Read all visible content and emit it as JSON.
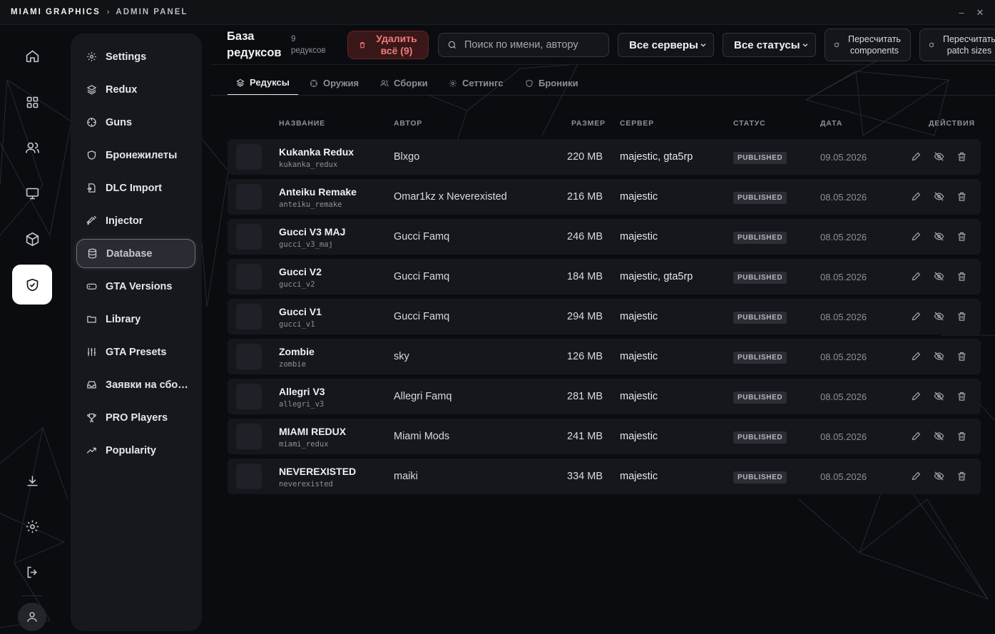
{
  "titlebar": {
    "app": "MIAMI GRAPHICS",
    "separator": "›",
    "section": "ADMIN PANEL",
    "minimize": "–",
    "close": "✕"
  },
  "rail": {
    "items": [
      "home-icon",
      "grid-icon",
      "users-icon",
      "monitor-icon",
      "cube-icon",
      "shield-check-icon",
      "download-icon",
      "gear-icon",
      "logout-icon"
    ],
    "active": "shield-check-icon",
    "avatar": "user-icon"
  },
  "sidebar": {
    "items": [
      {
        "label": "Settings",
        "icon": "gear-icon"
      },
      {
        "label": "Redux",
        "icon": "layers-icon"
      },
      {
        "label": "Guns",
        "icon": "crosshair-icon"
      },
      {
        "label": "Бронежилеты",
        "icon": "shield-icon"
      },
      {
        "label": "DLC Import",
        "icon": "file-import-icon"
      },
      {
        "label": "Injector",
        "icon": "syringe-icon"
      },
      {
        "label": "Database",
        "icon": "database-icon",
        "active": true
      },
      {
        "label": "GTA Versions",
        "icon": "gamepad-icon"
      },
      {
        "label": "Library",
        "icon": "folder-icon"
      },
      {
        "label": "GTA Presets",
        "icon": "sliders-icon"
      },
      {
        "label": "Заявки на сбо…",
        "icon": "inbox-icon"
      },
      {
        "label": "PRO Players",
        "icon": "trophy-icon"
      },
      {
        "label": "Popularity",
        "icon": "trend-icon"
      }
    ]
  },
  "header": {
    "title_line1": "База",
    "title_line2": "редуксов",
    "count_line1": "9",
    "count_line2": "редуксов",
    "delete_line1": "Удалить",
    "delete_line2": "всё (9)",
    "search_placeholder": "Поиск по имени, автору",
    "server_filter": "Все серверы",
    "status_filter": "Все статусы",
    "recalc1_line1": "Пересчитать",
    "recalc1_line2": "components",
    "recalc2_line1": "Пересчитать",
    "recalc2_line2": "patch sizes"
  },
  "tabs": [
    {
      "label": "Редуксы",
      "icon": "layers-icon",
      "active": true
    },
    {
      "label": "Оружия",
      "icon": "crosshair-icon"
    },
    {
      "label": "Сборки",
      "icon": "users-icon"
    },
    {
      "label": "Сеттингс",
      "icon": "gear-icon"
    },
    {
      "label": "Броники",
      "icon": "shield-icon"
    }
  ],
  "table": {
    "columns": [
      "НАЗВАНИЕ",
      "АВТОР",
      "РАЗМЕР",
      "СЕРВЕР",
      "СТАТУС",
      "ДАТА",
      "ДЕЙСТВИЯ"
    ],
    "rows": [
      {
        "name": "Kukanka Redux",
        "slug": "kukanka_redux",
        "author": "Blxgo",
        "size": "220 MB",
        "server": "majestic, gta5rp",
        "status": "PUBLISHED",
        "date": "09.05.2026"
      },
      {
        "name": "Anteiku Remake",
        "slug": "anteiku_remake",
        "author": "Omar1kz x Neverexisted",
        "size": "216 MB",
        "server": "majestic",
        "status": "PUBLISHED",
        "date": "08.05.2026"
      },
      {
        "name": "Gucci V3 MAJ",
        "slug": "gucci_v3_maj",
        "author": "Gucci Famq",
        "size": "246 MB",
        "server": "majestic",
        "status": "PUBLISHED",
        "date": "08.05.2026"
      },
      {
        "name": "Gucci V2",
        "slug": "gucci_v2",
        "author": "Gucci Famq",
        "size": "184 MB",
        "server": "majestic, gta5rp",
        "status": "PUBLISHED",
        "date": "08.05.2026"
      },
      {
        "name": "Gucci V1",
        "slug": "gucci_v1",
        "author": "Gucci Famq",
        "size": "294 MB",
        "server": "majestic",
        "status": "PUBLISHED",
        "date": "08.05.2026"
      },
      {
        "name": "Zombie",
        "slug": "zombie",
        "author": "sky",
        "size": "126 MB",
        "server": "majestic",
        "status": "PUBLISHED",
        "date": "08.05.2026"
      },
      {
        "name": "Allegri V3",
        "slug": "allegri_v3",
        "author": "Allegri Famq",
        "size": "281 MB",
        "server": "majestic",
        "status": "PUBLISHED",
        "date": "08.05.2026"
      },
      {
        "name": "MIAMI REDUX",
        "slug": "miami_redux",
        "author": "Miami Mods",
        "size": "241 MB",
        "server": "majestic",
        "status": "PUBLISHED",
        "date": "08.05.2026"
      },
      {
        "name": "NEVEREXISTED",
        "slug": "neverexisted",
        "author": "maiki",
        "size": "334 MB",
        "server": "majestic",
        "status": "PUBLISHED",
        "date": "08.05.2026"
      }
    ],
    "row_actions": [
      "edit-icon",
      "hide-icon",
      "trash-icon"
    ]
  },
  "colors": {
    "accent_danger": "#f07b7b",
    "background": "#0b0c10",
    "panel": "#17181d",
    "row": "#16171c"
  }
}
